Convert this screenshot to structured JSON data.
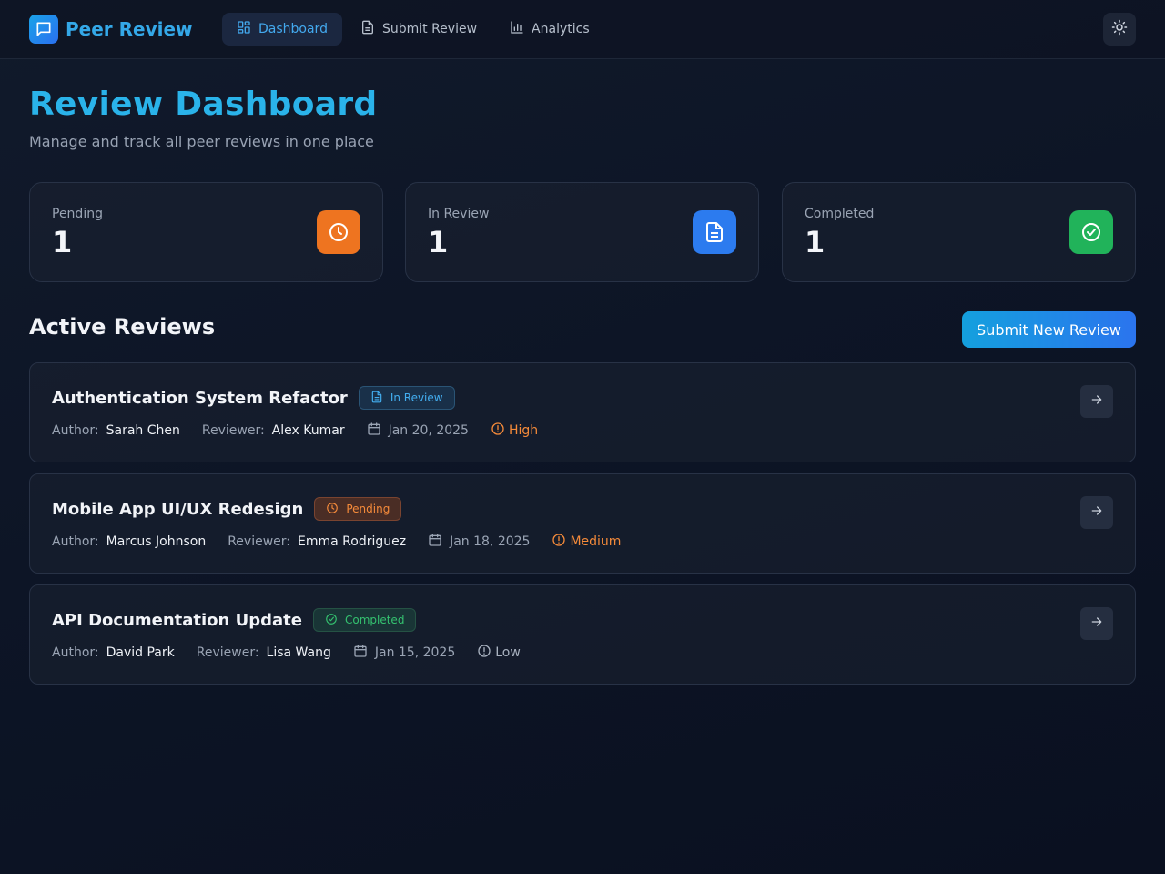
{
  "app": {
    "name": "Peer Review",
    "logo_icon": "chat-bubble-icon",
    "accent_color": "#2ab3ea"
  },
  "nav": {
    "items": [
      {
        "label": "Dashboard",
        "icon": "grid-icon",
        "active": true
      },
      {
        "label": "Submit Review",
        "icon": "document-icon",
        "active": false
      },
      {
        "label": "Analytics",
        "icon": "bar-chart-icon",
        "active": false
      }
    ],
    "theme_toggle_icon": "sun-icon"
  },
  "page": {
    "title": "Review Dashboard",
    "subtitle": "Manage and track all peer reviews in one place"
  },
  "stats": [
    {
      "label": "Pending",
      "value": "1",
      "icon": "clock-icon",
      "color": "#ee7420"
    },
    {
      "label": "In Review",
      "value": "1",
      "icon": "document-icon",
      "color": "#2c7bef"
    },
    {
      "label": "Completed",
      "value": "1",
      "icon": "check-circle-icon",
      "color": "#21b35a"
    }
  ],
  "section": {
    "title": "Active Reviews",
    "primary_button": "Submit New Review"
  },
  "reviews": [
    {
      "title": "Authentication System Refactor",
      "status": "In Review",
      "status_icon": "document-icon",
      "author_label": "Author:",
      "author": "Sarah Chen",
      "reviewer_label": "Reviewer:",
      "reviewer": "Alex Kumar",
      "date": "Jan 20, 2025",
      "priority": "High"
    },
    {
      "title": "Mobile App UI/UX Redesign",
      "status": "Pending",
      "status_icon": "clock-icon",
      "author_label": "Author:",
      "author": "Marcus Johnson",
      "reviewer_label": "Reviewer:",
      "reviewer": "Emma Rodriguez",
      "date": "Jan 18, 2025",
      "priority": "Medium"
    },
    {
      "title": "API Documentation Update",
      "status": "Completed",
      "status_icon": "check-circle-icon",
      "author_label": "Author:",
      "author": "David Park",
      "reviewer_label": "Reviewer:",
      "reviewer": "Lisa Wang",
      "date": "Jan 15, 2025",
      "priority": "Low"
    }
  ]
}
